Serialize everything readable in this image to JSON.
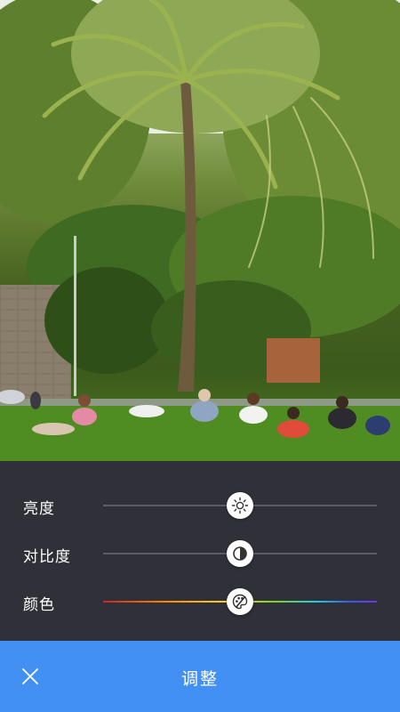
{
  "photo": {
    "icon": "photo-preview"
  },
  "adjustments": {
    "brightness": {
      "label": "亮度",
      "icon": "sun-icon",
      "value": 0.5
    },
    "contrast": {
      "label": "对比度",
      "icon": "contrast-icon",
      "value": 0.5
    },
    "color": {
      "label": "颜色",
      "icon": "color-palette-icon",
      "value": 0.5
    }
  },
  "bottom_bar": {
    "title": "调整",
    "close_icon": "close-icon",
    "color": "#4390f5"
  },
  "colors": {
    "panel_background": "#2f3038",
    "accent": "#4390f5"
  }
}
